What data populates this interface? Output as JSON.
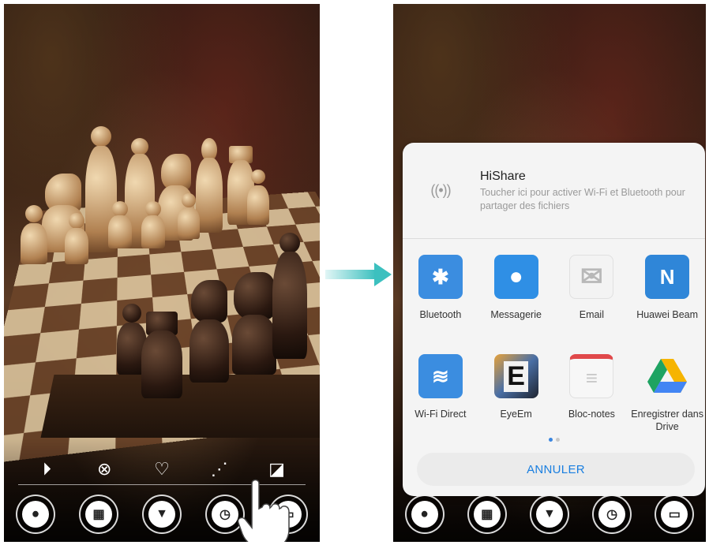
{
  "left_screen": {
    "action_bar": [
      {
        "icon": "play-circle-icon",
        "glyph": "⏵"
      },
      {
        "icon": "close-circle-icon",
        "glyph": "⊗"
      },
      {
        "icon": "heart-icon",
        "glyph": "♡"
      },
      {
        "icon": "share-icon",
        "glyph": "⋰"
      },
      {
        "icon": "edit-image-icon",
        "glyph": "◪"
      }
    ],
    "dock": [
      {
        "icon": "recorder-icon",
        "glyph": "⦁"
      },
      {
        "icon": "calculator-icon",
        "glyph": "▦"
      },
      {
        "icon": "flashlight-icon",
        "glyph": "▼"
      },
      {
        "icon": "clock-icon",
        "glyph": "◷"
      },
      {
        "icon": "scanner-icon",
        "glyph": "▭"
      }
    ]
  },
  "arrow_color": "#3cc0bf",
  "share_sheet": {
    "hishare": {
      "icon_glyph": "((•))",
      "title": "HiShare",
      "description": "Toucher ici pour activer Wi-Fi et Bluetooth pour partager des fichiers"
    },
    "apps": [
      {
        "label": "Bluetooth",
        "icon": "bluetooth-icon",
        "glyph": "✱",
        "color": "#3b8de0"
      },
      {
        "label": "Messagerie",
        "icon": "message-bubble-icon",
        "glyph": "●",
        "color": "#2f8fe5"
      },
      {
        "label": "Email",
        "icon": "envelope-icon",
        "glyph": "✉",
        "color": "#f3f3f3"
      },
      {
        "label": "Huawei Beam",
        "icon": "nfc-icon",
        "glyph": "N",
        "color": "#2f86d8"
      },
      {
        "label": "Wi-Fi Direct",
        "icon": "wifi-direct-icon",
        "glyph": "≋",
        "color": "#3b8de0"
      },
      {
        "label": "EyeEm",
        "icon": "eyeem-icon",
        "glyph": "E",
        "color": "#2a2f3a"
      },
      {
        "label": "Bloc-notes",
        "icon": "notepad-icon",
        "glyph": "≡",
        "color": "#f7f7f7"
      },
      {
        "label": "Enregistrer dans Drive",
        "icon": "drive-icon",
        "glyph": "▲",
        "color": "#f4f4f4"
      }
    ],
    "page_indicator": {
      "active_color": "#3a86e0",
      "inactive_color": "#c8c8c8"
    },
    "cancel_label": "ANNULER"
  }
}
